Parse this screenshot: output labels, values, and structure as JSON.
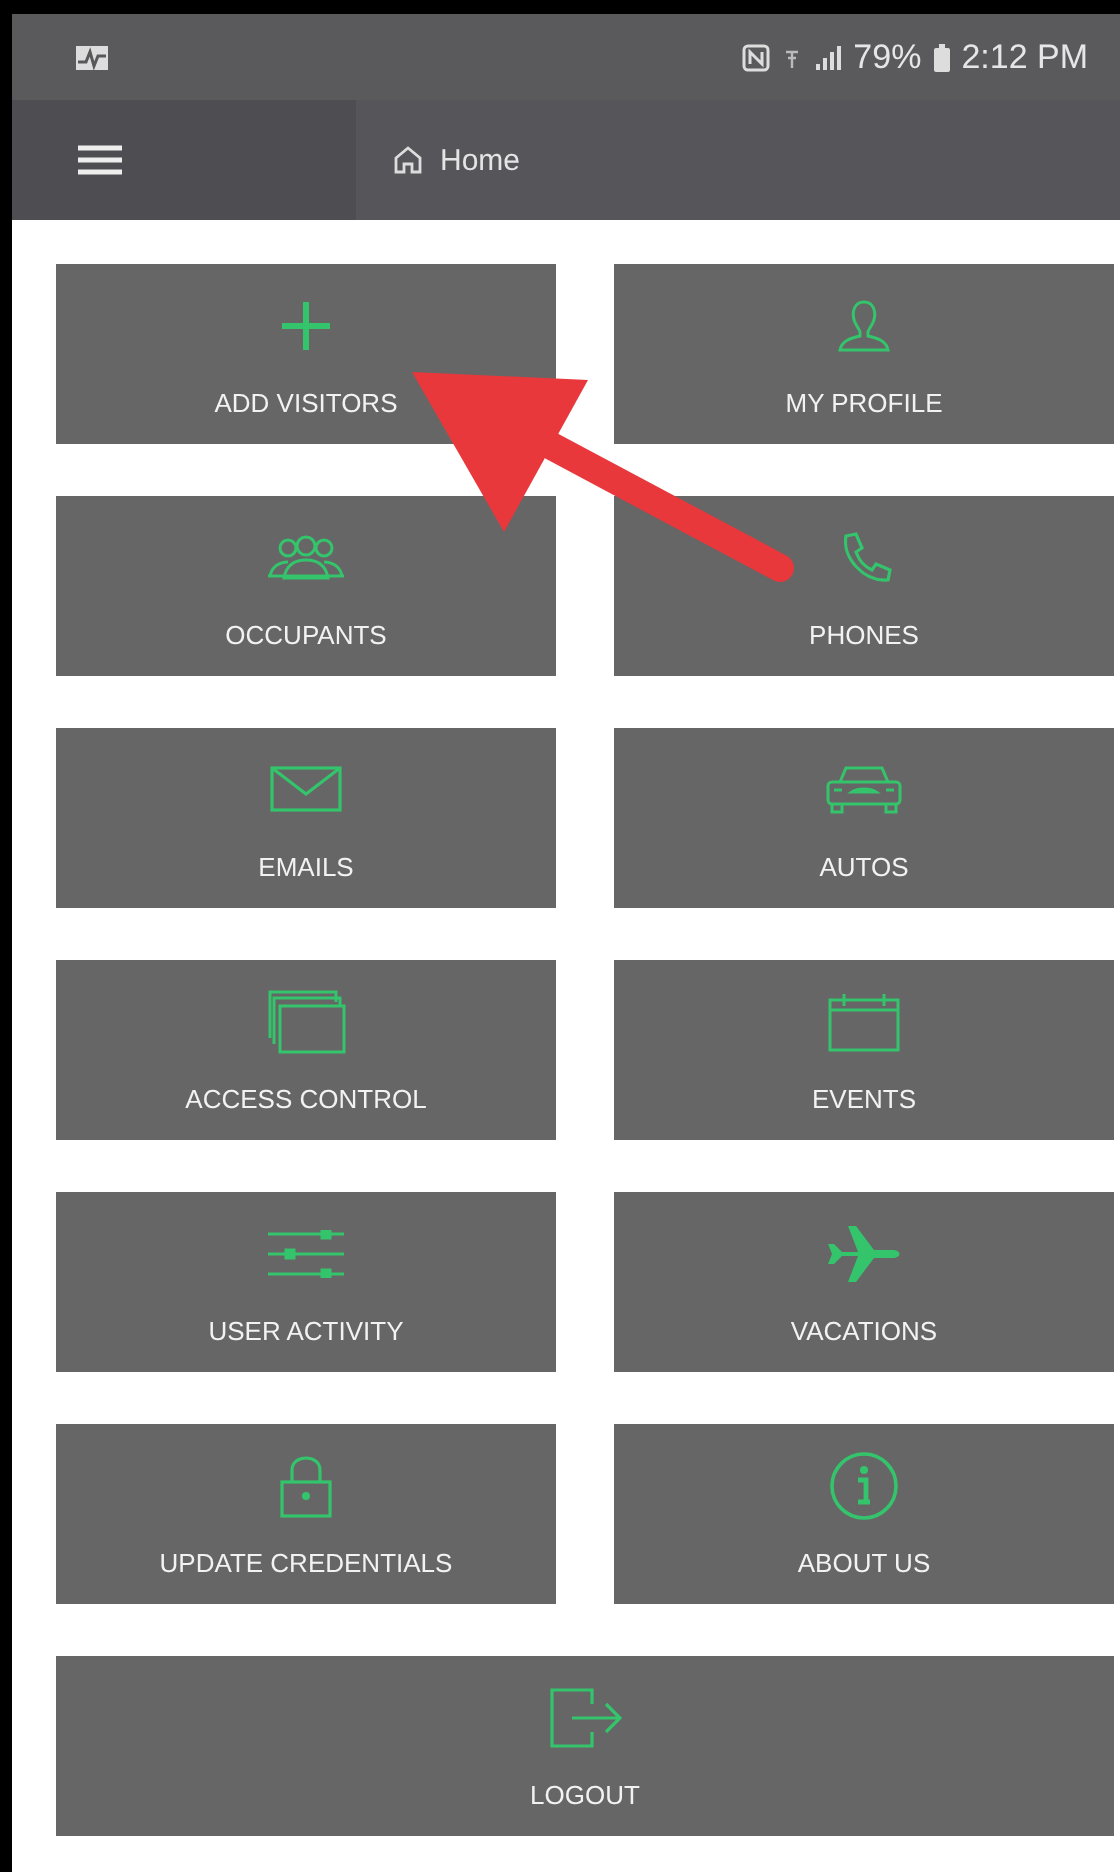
{
  "status_bar": {
    "battery": "79%",
    "time": "2:12 PM"
  },
  "toolbar": {
    "title": "Home"
  },
  "tiles": [
    {
      "label": "ADD VISITORS",
      "wide": false
    },
    {
      "label": "MY PROFILE",
      "wide": false
    },
    {
      "label": "OCCUPANTS",
      "wide": false
    },
    {
      "label": "PHONES",
      "wide": false
    },
    {
      "label": "EMAILS",
      "wide": false
    },
    {
      "label": "AUTOS",
      "wide": false
    },
    {
      "label": "ACCESS CONTROL",
      "wide": false
    },
    {
      "label": "EVENTS",
      "wide": false
    },
    {
      "label": "USER ACTIVITY",
      "wide": false
    },
    {
      "label": "VACATIONS",
      "wide": false
    },
    {
      "label": "UPDATE CREDENTIALS",
      "wide": false
    },
    {
      "label": "ABOUT US",
      "wide": false
    },
    {
      "label": "LOGOUT",
      "wide": true
    }
  ]
}
